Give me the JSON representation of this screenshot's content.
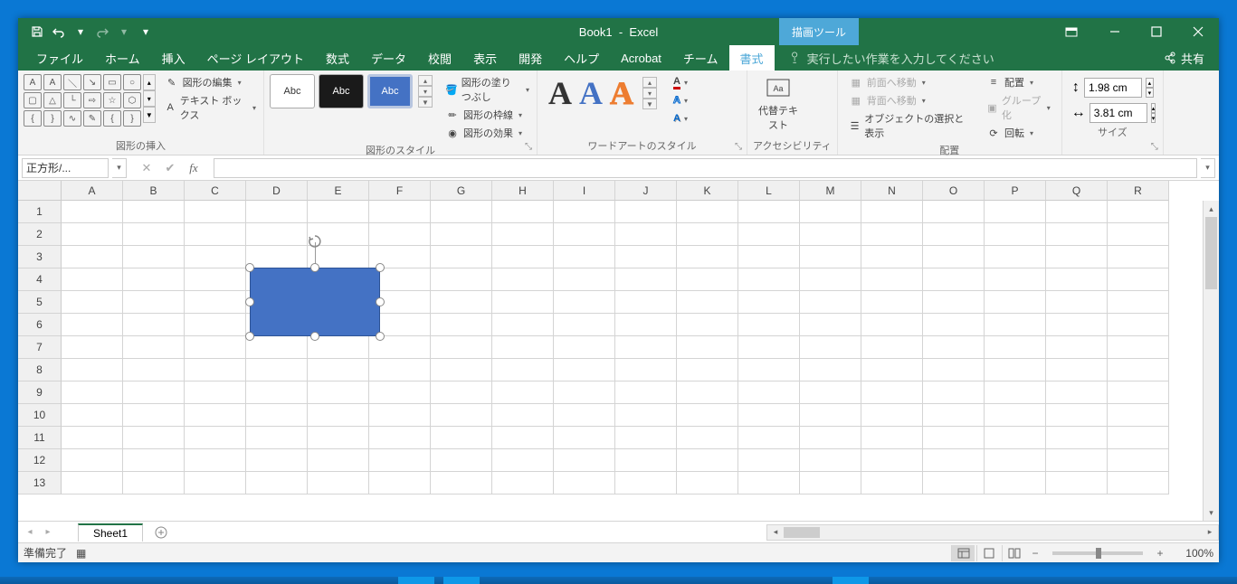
{
  "title": {
    "doc": "Book1",
    "app": "Excel",
    "context_tool": "描画ツール"
  },
  "tabs": [
    "ファイル",
    "ホーム",
    "挿入",
    "ページ レイアウト",
    "数式",
    "データ",
    "校閲",
    "表示",
    "開発",
    "ヘルプ",
    "Acrobat",
    "チーム",
    "書式"
  ],
  "tellme": "実行したい作業を入力してください",
  "share": "共有",
  "ribbon": {
    "insert_shapes": {
      "label": "図形の挿入",
      "edit_shape": "図形の編集",
      "text_box": "テキスト ボックス"
    },
    "shape_styles": {
      "label": "図形のスタイル",
      "sample": "Abc",
      "fill": "図形の塗りつぶし",
      "outline": "図形の枠線",
      "effects": "図形の効果"
    },
    "wordart": {
      "label": "ワードアートのスタイル"
    },
    "accessibility": {
      "label": "アクセシビリティ",
      "alt_text": "代替テキスト"
    },
    "arrange": {
      "label": "配置",
      "bring_forward": "前面へ移動",
      "send_backward": "背面へ移動",
      "selection_pane": "オブジェクトの選択と表示",
      "align": "配置",
      "group": "グループ化",
      "rotate": "回転"
    },
    "size": {
      "label": "サイズ",
      "height": "1.98 cm",
      "width": "3.81 cm"
    }
  },
  "name_box": "正方形/...",
  "columns": [
    "A",
    "B",
    "C",
    "D",
    "E",
    "F",
    "G",
    "H",
    "I",
    "J",
    "K",
    "L",
    "M",
    "N",
    "O",
    "P",
    "Q",
    "R"
  ],
  "rows": [
    "1",
    "2",
    "3",
    "4",
    "5",
    "6",
    "7",
    "8",
    "9",
    "10",
    "11",
    "12",
    "13"
  ],
  "sheet_tab": "Sheet1",
  "status": {
    "ready": "準備完了",
    "zoom": "100%"
  }
}
